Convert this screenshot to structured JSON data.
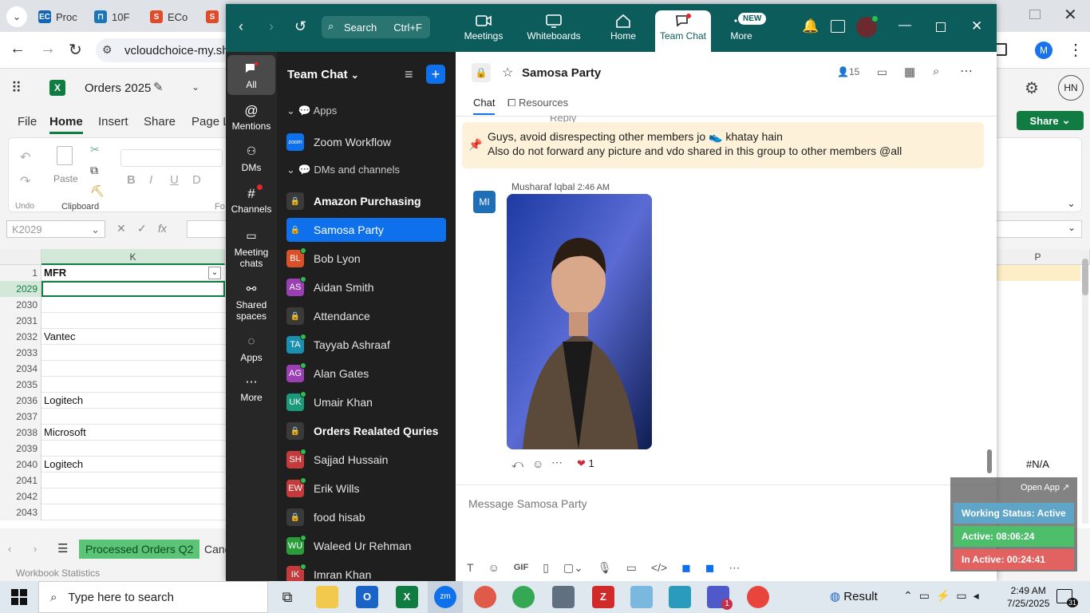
{
  "browser": {
    "tabs": [
      {
        "label": "Proc"
      },
      {
        "label": "10F"
      },
      {
        "label": "ECo"
      },
      {
        "label": ""
      }
    ],
    "url": "vcloudchoice-my.sha"
  },
  "excel": {
    "file_title": "Orders 2025",
    "menu": [
      "File",
      "Home",
      "Insert",
      "Share",
      "Page La"
    ],
    "ribbon": {
      "undo": "Undo",
      "paste": "Paste",
      "clipboard": "Clipboard",
      "font_partial": "Fo"
    },
    "namebox": "K2029",
    "column_k": "K",
    "column_p": "P",
    "header_row_num": "1",
    "header_cell": "MFR",
    "rows": [
      {
        "num": "2029",
        "value": ""
      },
      {
        "num": "2030",
        "value": ""
      },
      {
        "num": "2031",
        "value": ""
      },
      {
        "num": "2032",
        "value": "Vantec"
      },
      {
        "num": "2033",
        "value": ""
      },
      {
        "num": "2034",
        "value": ""
      },
      {
        "num": "2035",
        "value": ""
      },
      {
        "num": "2036",
        "value": "Logitech"
      },
      {
        "num": "2037",
        "value": ""
      },
      {
        "num": "2038",
        "value": "Microsoft"
      },
      {
        "num": "2039",
        "value": ""
      },
      {
        "num": "2040",
        "value": "Logitech"
      },
      {
        "num": "2041",
        "value": ""
      },
      {
        "num": "2042",
        "value": ""
      },
      {
        "num": "2043",
        "value": ""
      }
    ],
    "na_value": "#N/A",
    "share_label": "Share",
    "avatar_initials": "HN",
    "sheet_tab": "Processed Orders Q2",
    "sheet_tab2": "Canc",
    "status": "Workbook Statistics",
    "profile_letter": "M"
  },
  "zoom": {
    "search_label": "Search",
    "search_shortcut": "Ctrl+F",
    "nav": [
      {
        "label": "Meetings"
      },
      {
        "label": "Whiteboards"
      },
      {
        "label": "Home"
      },
      {
        "label": "Team Chat"
      },
      {
        "label": "More"
      }
    ],
    "new_badge": "NEW",
    "sidebar": [
      {
        "label": "All"
      },
      {
        "label": "Mentions"
      },
      {
        "label": "DMs"
      },
      {
        "label": "Channels"
      },
      {
        "label": "Meeting chats"
      },
      {
        "label": "Shared spaces"
      },
      {
        "label": "Apps"
      },
      {
        "label": "More"
      }
    ],
    "list_title": "Team Chat",
    "section_apps": "Apps",
    "zoom_workflow": "Zoom Workflow",
    "zoom_logo": "zoom",
    "section_dms": "DMs and channels",
    "contacts": [
      {
        "name": "Amazon Purchasing",
        "initials": "",
        "color": "#555",
        "type": "lock",
        "bold": true
      },
      {
        "name": "Samosa Party",
        "initials": "",
        "color": "#555",
        "type": "lock",
        "selected": true
      },
      {
        "name": "Bob Lyon",
        "initials": "BL",
        "color": "#d9502a",
        "online": true
      },
      {
        "name": "Aidan Smith",
        "initials": "AS",
        "color": "#9b3fb5",
        "online": true
      },
      {
        "name": "Attendance",
        "initials": "",
        "color": "#555",
        "type": "lock"
      },
      {
        "name": "Tayyab Ashraaf",
        "initials": "TA",
        "color": "#1a8fb0",
        "online": true
      },
      {
        "name": "Alan Gates",
        "initials": "AG",
        "color": "#9b3fb5",
        "online": true
      },
      {
        "name": "Umair Khan",
        "initials": "UK",
        "color": "#1a9a7a",
        "online": true
      },
      {
        "name": "Orders Realated Quries",
        "initials": "",
        "color": "#555",
        "type": "lock",
        "bold": true
      },
      {
        "name": "Sajjad Hussain",
        "initials": "SH",
        "color": "#c53b3b",
        "online": true
      },
      {
        "name": "Erik Wills",
        "initials": "EW",
        "color": "#c53b3b",
        "online": true
      },
      {
        "name": "food hisab",
        "initials": "",
        "color": "#555",
        "type": "lock"
      },
      {
        "name": "Waleed Ur Rehman",
        "initials": "WU",
        "color": "#2a9d3a",
        "online": true
      },
      {
        "name": "Imran Khan",
        "initials": "IK",
        "color": "#c53b3b",
        "online": true
      }
    ],
    "chat": {
      "title": "Samosa Party",
      "members": "15",
      "tabs": [
        "Chat",
        "Resources"
      ],
      "reply_label": "Reply",
      "pinned_line1": "Guys, avoid disrespecting other members jo 👟 khatay hain",
      "pinned_line2": "Also do not forward any picture and vdo shared in this group to other members @all",
      "sender_name": "Musharaf Iqbal",
      "sender_time": "2:46 AM",
      "sender_initials": "MI",
      "reaction_count": "1",
      "composer_placeholder": "Message Samosa Party",
      "gif_label": "GIF"
    }
  },
  "status_overlay": {
    "open_app": "Open App ↗",
    "working": "Working Status: Active",
    "active": "Active: 08:06:24",
    "inactive": "In Active: 00:24:41"
  },
  "taskbar": {
    "search_placeholder": "Type here to search",
    "weather": "Result",
    "time": "2:49 AM",
    "date": "7/25/2025",
    "notif_count": "31",
    "teams_badge": "1"
  }
}
